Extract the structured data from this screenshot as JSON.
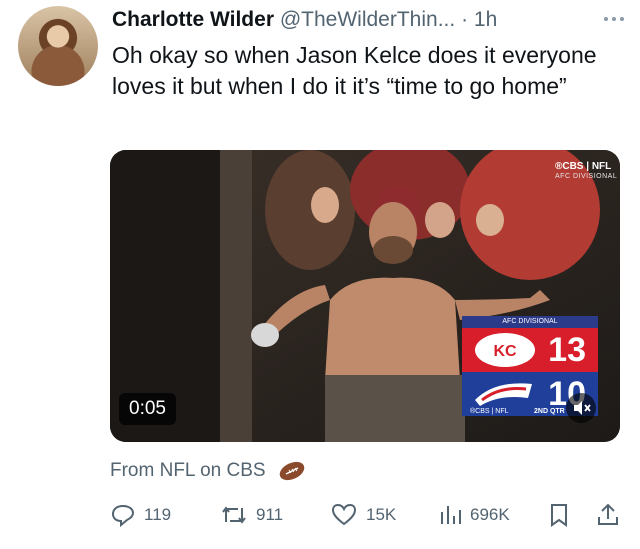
{
  "tweet": {
    "author_name": "Charlotte Wilder",
    "handle": "@TheWilderThin...",
    "separator": "·",
    "time": "1h",
    "text": "Oh okay so when Jason Kelce does it everyone loves it but when I do it it’s “time to go home”",
    "more_icon": "ellipsis-icon"
  },
  "media": {
    "duration": "0:05",
    "network_bug": "®CBS | NFL",
    "network_sub": "AFC DIVISIONAL",
    "scoreboard": {
      "title": "AFC DIVISIONAL",
      "home_score": "13",
      "away_score": "10",
      "footer_left": "®CBS | NFL",
      "quarter": "2ND QTR"
    },
    "mute_icon": "speaker-muted-icon"
  },
  "source": {
    "label": "From NFL on CBS",
    "emoji": "american-football-icon"
  },
  "actions": {
    "replies": "119",
    "reposts": "911",
    "likes": "15K",
    "views": "696K",
    "icons": [
      "reply-icon",
      "repost-icon",
      "like-icon",
      "views-icon",
      "bookmark-icon",
      "share-icon"
    ],
    "accent": "#536471"
  }
}
